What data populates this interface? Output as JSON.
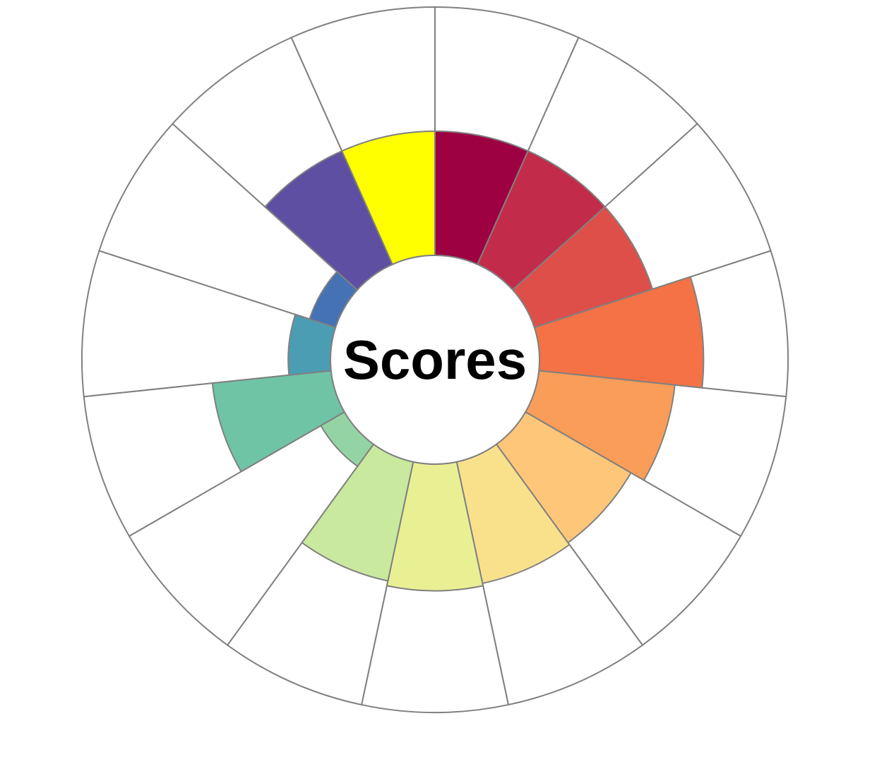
{
  "chart_data": {
    "type": "radial-bar",
    "title": "Scores",
    "max_value": 1,
    "segments": [
      {
        "value": 0.5,
        "color": "#9e0142"
      },
      {
        "value": 0.5,
        "color": "#c22c4a"
      },
      {
        "value": 0.5,
        "color": "#de4f4a"
      },
      {
        "value": 0.66,
        "color": "#f47245"
      },
      {
        "value": 0.55,
        "color": "#fa9d59"
      },
      {
        "value": 0.49,
        "color": "#fdc679"
      },
      {
        "value": 0.5,
        "color": "#f9e18c"
      },
      {
        "value": 0.51,
        "color": "#e9f094"
      },
      {
        "value": 0.49,
        "color": "#c9e99e"
      },
      {
        "value": 0.11,
        "color": "#94d4a4"
      },
      {
        "value": 0.48,
        "color": "#6fc4a6"
      },
      {
        "value": 0.17,
        "color": "#4b9db3"
      },
      {
        "value": 0.11,
        "color": "#4472b4"
      },
      {
        "value": 0.5,
        "color": "#5e4fa2"
      },
      {
        "value": 0.5,
        "color": "#ffff00"
      }
    ]
  }
}
